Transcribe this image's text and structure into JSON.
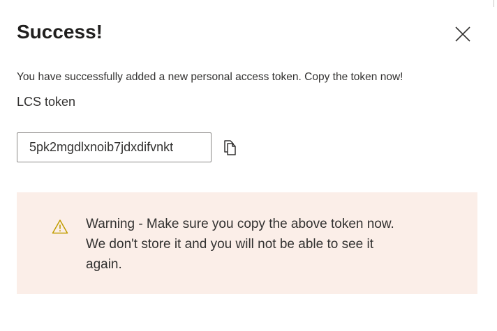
{
  "dialog": {
    "title": "Success!",
    "close_icon": "close-icon",
    "message": "You have successfully added a new personal access token. Copy the token now!",
    "token_field": {
      "label": "LCS token",
      "value": "5pk2mgdlxnoib7jdxdifvnkt"
    },
    "copy_icon": "copy-icon",
    "warning": {
      "icon": "warning-triangle-icon",
      "lines": [
        "Warning - Make sure you copy the above token now.",
        "We don't store it and you will not be able to see it",
        "again."
      ]
    }
  },
  "colors": {
    "warning_background": "#fbeee8",
    "warning_icon": "#c19c00",
    "text": "#323130",
    "input_border": "#8a8886"
  }
}
